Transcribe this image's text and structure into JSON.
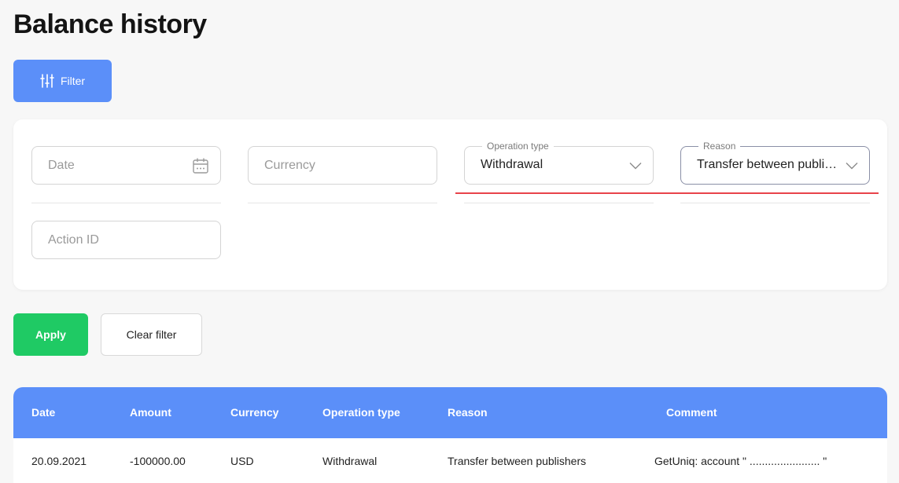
{
  "page": {
    "title": "Balance history"
  },
  "toolbar": {
    "filter_label": "Filter"
  },
  "filters": {
    "date": {
      "placeholder": "Date"
    },
    "currency": {
      "placeholder": "Currency"
    },
    "operation_type": {
      "label": "Operation type",
      "value": "Withdrawal"
    },
    "reason": {
      "label": "Reason",
      "value": "Transfer between publishers"
    },
    "action_id": {
      "placeholder": "Action ID"
    }
  },
  "actions": {
    "apply_label": "Apply",
    "clear_label": "Clear filter"
  },
  "table": {
    "columns": [
      "Date",
      "Amount",
      "Currency",
      "Operation type",
      "Reason",
      "Comment"
    ],
    "rows": [
      [
        "20.09.2021",
        "-100000.00",
        "USD",
        "Withdrawal",
        "Transfer between publishers",
        "GetUniq: account \" ....................... \""
      ]
    ]
  },
  "colors": {
    "primary": "#5b8ff9",
    "success": "#1fca64",
    "error": "#e8434a"
  },
  "icons": {
    "filter": "sliders-icon",
    "date": "calendar-icon",
    "select": "chevron-down-icon"
  }
}
